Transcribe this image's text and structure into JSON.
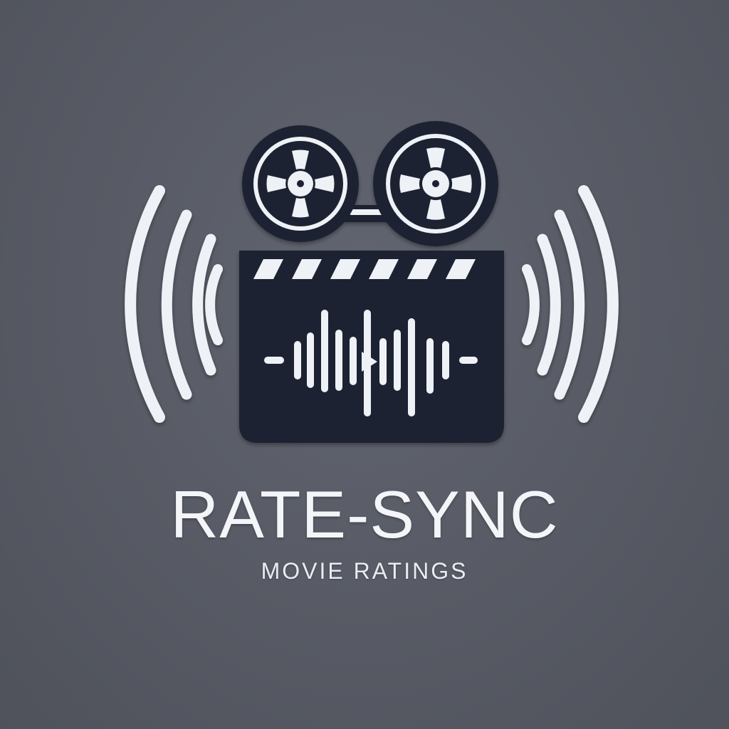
{
  "brand": {
    "title": "RATE-SYNC",
    "subtitle": "MOVIE RATINGS"
  },
  "colors": {
    "background": "#595c66",
    "dark_navy": "#1b2230",
    "light": "#eef1f6"
  },
  "icons": {
    "main": "film-camera-clapperboard-icon",
    "waves": "sound-wave-icon",
    "play": "play-icon"
  }
}
